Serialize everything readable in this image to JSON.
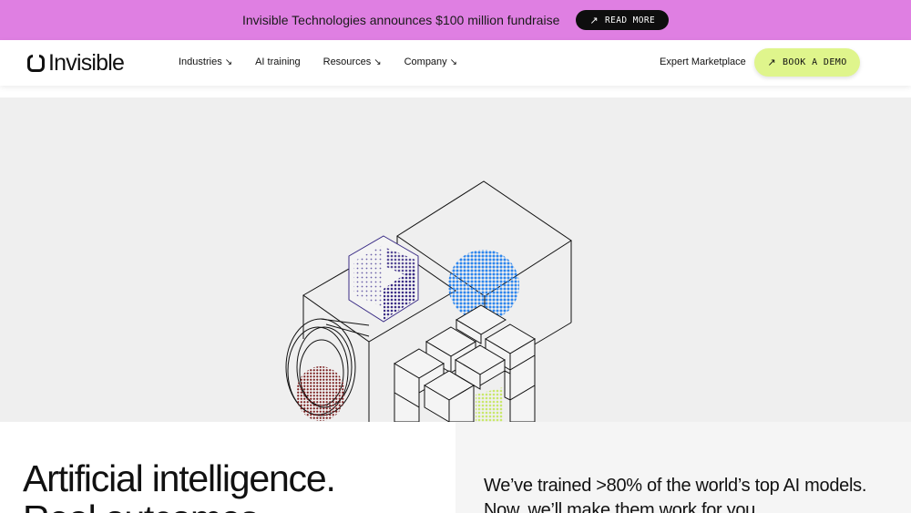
{
  "banner": {
    "text": "Invisible Technologies announces $100 million fundraise",
    "button_label": "READ MORE",
    "background": "#df7fe2"
  },
  "nav": {
    "logo_text": "Invisible",
    "links": [
      {
        "label": "Industries",
        "has_arrow": true
      },
      {
        "label": "AI training",
        "has_arrow": false
      },
      {
        "label": "Resources",
        "has_arrow": true
      },
      {
        "label": "Company",
        "has_arrow": true
      }
    ],
    "expert_link": "Expert Marketplace",
    "demo_button": "BOOK A DEMO",
    "demo_color": "#dff58c"
  },
  "hero": {
    "illustration": "isometric-cube-camera-illustration",
    "background": "#efefef",
    "dot_colors": {
      "purple": "#3b2d86",
      "blue": "#2d86ee",
      "maroon": "#7a1e1e",
      "lime": "#d8f07a"
    }
  },
  "headline": {
    "line1": "Artificial intelligence.",
    "line2": "Real outcomes."
  },
  "tagline": {
    "line1": "We’ve trained >80% of the world’s top AI models.",
    "line2": "Now, we’ll make them work for you."
  }
}
